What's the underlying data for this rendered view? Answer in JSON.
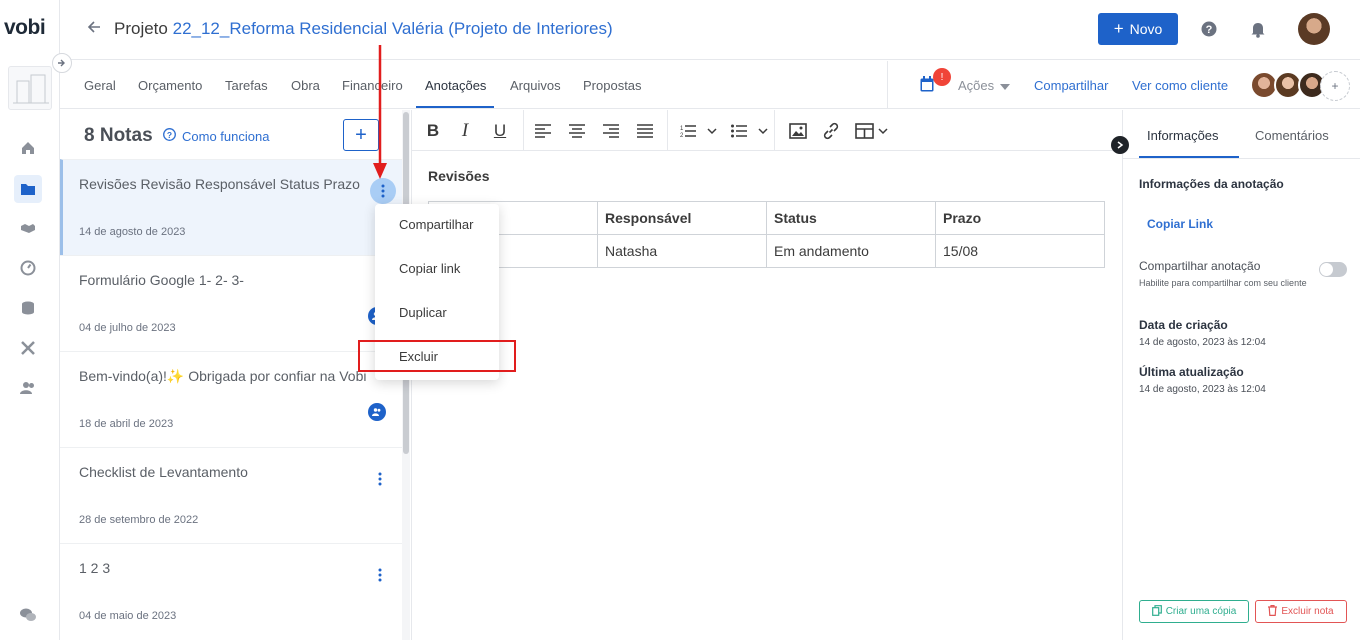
{
  "app": {
    "logo": "vobi"
  },
  "header": {
    "project_prefix": "Projeto",
    "project_name": "22_12_Reforma Residencial Valéria (Projeto de Interiores)",
    "new_button": "Novo",
    "icons": {
      "back": "back-arrow-icon",
      "help": "help-icon",
      "notifications": "bell-icon"
    }
  },
  "tabs": [
    {
      "label": "Geral"
    },
    {
      "label": "Orçamento"
    },
    {
      "label": "Tarefas"
    },
    {
      "label": "Obra"
    },
    {
      "label": "Financeiro"
    },
    {
      "label": "Anotações",
      "active": true
    },
    {
      "label": "Arquivos"
    },
    {
      "label": "Propostas"
    }
  ],
  "tab_actions": {
    "calendar_badge": "!",
    "actions": "Ações",
    "share": "Compartilhar",
    "view_as_client": "Ver como cliente",
    "team_more": "+"
  },
  "notes_panel": {
    "count_label": "8 Notas",
    "how_it_works": "Como funciona",
    "add_button": "+",
    "notes": [
      {
        "title": "Revisões Revisão Responsável Status Prazo",
        "date": "14 de agosto de 2023",
        "selected": true
      },
      {
        "title": "Formulário Google 1-  2-  3-",
        "date": "04 de julho de 2023",
        "shared": true
      },
      {
        "title": "Bem-vindo(a)!✨ Obrigada por confiar na Vobi",
        "date": "18 de abril de 2023",
        "shared": true
      },
      {
        "title": "Checklist de Levantamento",
        "date": "28 de setembro de 2022"
      },
      {
        "title": "1 2 3",
        "date": "04 de maio de 2023"
      }
    ]
  },
  "context_menu": {
    "items": [
      "Compartilhar",
      "Copiar link",
      "Duplicar",
      "Excluir"
    ],
    "highlighted": "Excluir"
  },
  "editor": {
    "toolbar": [
      "bold-icon",
      "italic-icon",
      "underline-icon",
      "align-left-icon",
      "align-center-icon",
      "align-right-icon",
      "align-justify-icon",
      "ordered-list-icon",
      "bullet-list-icon",
      "image-icon",
      "link-icon",
      "table-icon"
    ],
    "heading": "Revisões",
    "table": {
      "headers": [
        "",
        "Responsável",
        "Status",
        "Prazo"
      ],
      "rows": [
        [
          "",
          "Natasha",
          "Em andamento",
          "15/08"
        ]
      ]
    }
  },
  "right_panel": {
    "tab_info": "Informações",
    "tab_comments": "Comentários",
    "section_title": "Informações da anotação",
    "copy_link": "Copiar Link",
    "share_label": "Compartilhar anotação",
    "share_help": "Habilite para compartilhar com seu cliente",
    "share_enabled": false,
    "created_label": "Data de criação",
    "created_value": "14 de agosto, 2023 às 12:04",
    "updated_label": "Última atualização",
    "updated_value": "14 de agosto, 2023 às 12:04",
    "copy_button": "Criar uma cópia",
    "delete_button": "Excluir nota"
  },
  "colors": {
    "primary": "#1e62c9",
    "link": "#2f6fd1",
    "danger": "#e11d1d",
    "success": "#2fae8f"
  }
}
